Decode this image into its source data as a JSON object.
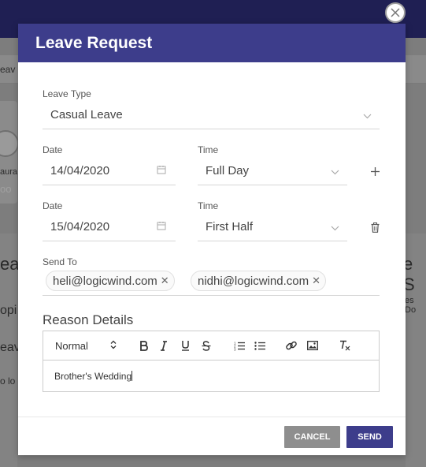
{
  "backdrop": {
    "strip_text": "eav",
    "left_name": "aura",
    "left_sub": "oo",
    "left_heading": "ea",
    "left_item1": "opi",
    "left_item2": "eav",
    "left_item3": "o lo",
    "right_heading": "e S",
    "right_sub": "es Do"
  },
  "modal": {
    "title": "Leave Request",
    "leave_type": {
      "label": "Leave Type",
      "value": "Casual Leave"
    },
    "rows": [
      {
        "date_label": "Date",
        "date_value": "14/04/2020",
        "time_label": "Time",
        "time_value": "Full Day",
        "action_icon": "plus-icon"
      },
      {
        "date_label": "Date",
        "date_value": "15/04/2020",
        "time_label": "Time",
        "time_value": "First Half",
        "action_icon": "trash-icon"
      }
    ],
    "send_to": {
      "label": "Send To",
      "recipients": [
        "heli@logicwind.com",
        "nidhi@logicwind.com"
      ]
    },
    "reason": {
      "title": "Reason Details",
      "format_select": "Normal",
      "text": "Brother's Wedding"
    },
    "buttons": {
      "cancel": "CANCEL",
      "send": "SEND"
    }
  },
  "colors": {
    "header": "#3d3d8b",
    "send_button": "#3d3d8b",
    "cancel_button": "#8e8e8e",
    "overlay": "#7d7d7d"
  }
}
